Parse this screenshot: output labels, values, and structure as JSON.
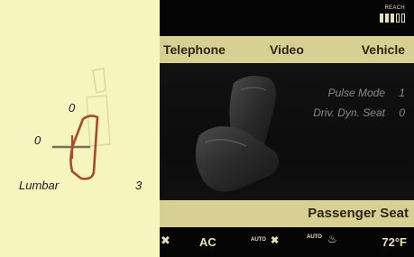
{
  "seat_adjust": {
    "backrest_value": "0",
    "headrest_value": "0",
    "lumbar_label": "Lumbar",
    "lumbar_value": "3"
  },
  "top_bar": {
    "reach_label": "REACH"
  },
  "menu": {
    "items": [
      "Telephone",
      "Video",
      "Vehicle"
    ]
  },
  "settings": [
    {
      "label": "Pulse Mode",
      "value": "1"
    },
    {
      "label": "Driv. Dyn. Seat",
      "value": "0"
    }
  ],
  "title_bar": {
    "title": "Passenger Seat"
  },
  "status_bar": {
    "ac_label": "AC",
    "auto_fan_label": "AUTO",
    "auto_seat_label": "AUTO",
    "temperature": "72°F"
  },
  "colors": {
    "accent": "#d8cf92",
    "panel": "#f6f5bf",
    "lumbar": "#a84a2c"
  }
}
